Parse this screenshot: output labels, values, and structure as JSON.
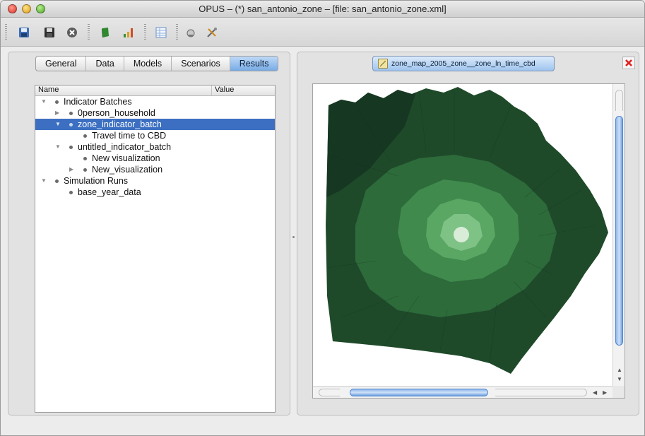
{
  "window": {
    "title": "OPUS – (*) san_antonio_zone – [file: san_antonio_zone.xml]"
  },
  "toolbar": {
    "buttons": [
      "save-as-icon",
      "save-icon",
      "close-project-icon",
      "book-icon",
      "bar-chart-icon",
      "table-icon",
      "console-icon",
      "tools-icon"
    ]
  },
  "left_panel": {
    "tabs": [
      {
        "label": "General",
        "active": false
      },
      {
        "label": "Data",
        "active": false
      },
      {
        "label": "Models",
        "active": false
      },
      {
        "label": "Scenarios",
        "active": false
      },
      {
        "label": "Results",
        "active": true
      }
    ],
    "tree": {
      "columns": {
        "name": "Name",
        "value": "Value"
      },
      "rows": [
        {
          "label": "Indicator Batches",
          "level": 0,
          "expander": "expanded",
          "selected": false
        },
        {
          "label": "0person_household",
          "level": 1,
          "expander": "collapsed",
          "selected": false
        },
        {
          "label": "zone_indicator_batch",
          "level": 1,
          "expander": "expanded",
          "selected": true
        },
        {
          "label": "Travel time to CBD",
          "level": 2,
          "expander": "none",
          "selected": false
        },
        {
          "label": "untitled_indicator_batch",
          "level": 1,
          "expander": "expanded",
          "selected": false
        },
        {
          "label": "New visualization",
          "level": 2,
          "expander": "none",
          "selected": false
        },
        {
          "label": "New_visualization",
          "level": 2,
          "expander": "collapsed",
          "selected": false
        },
        {
          "label": "Simulation Runs",
          "level": 0,
          "expander": "expanded",
          "selected": false
        },
        {
          "label": "base_year_data",
          "level": 1,
          "expander": "none",
          "selected": false
        }
      ]
    }
  },
  "right_panel": {
    "viz_tab_label": "zone_map_2005_zone__zone_ln_time_cbd",
    "map": {
      "colors": {
        "outer": "#1f4a2a",
        "outer_dark": "#163822",
        "ring1": "#2d6b3a",
        "ring2": "#3f8a4c",
        "ring3": "#5aa764",
        "ring4": "#7fc286",
        "core": "#d8ecd8"
      }
    }
  }
}
